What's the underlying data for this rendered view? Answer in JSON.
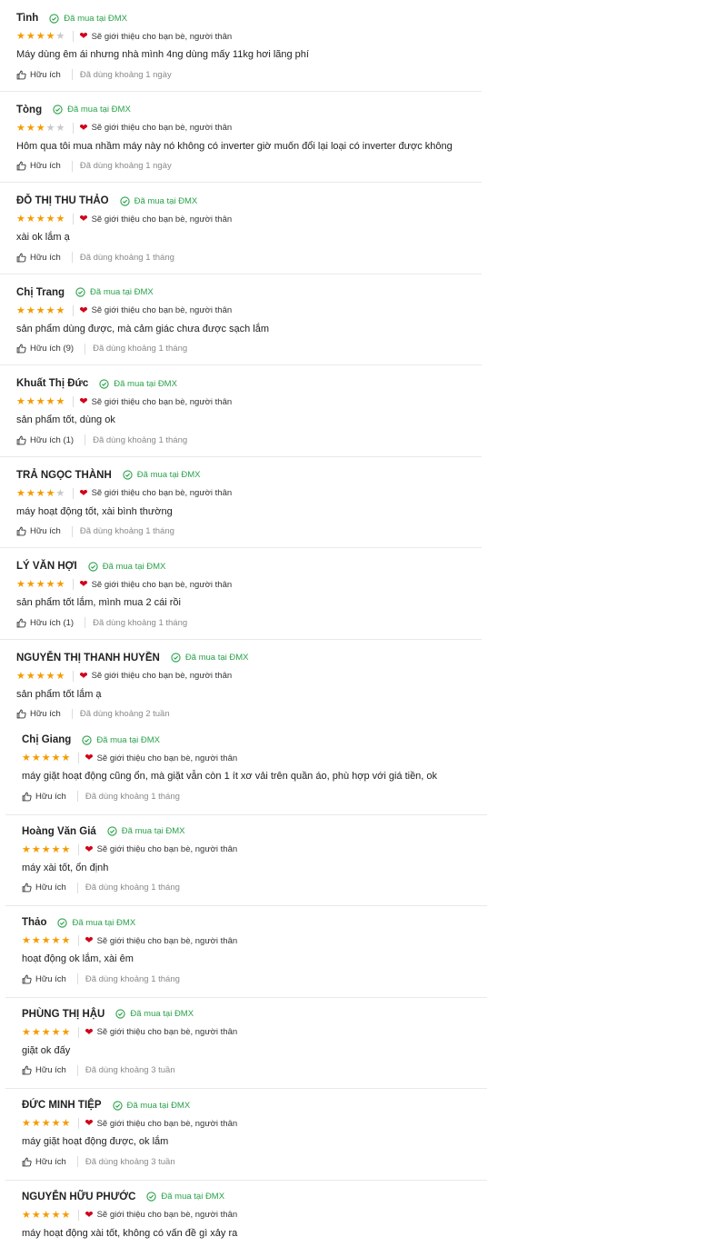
{
  "common": {
    "verified": "Đã mua tại ĐMX",
    "recommend": "Sẽ giới thiệu cho bạn bè, người thân",
    "helpful": "Hữu ích"
  },
  "colors": {
    "star": "#f59b00",
    "star_empty": "#c8c8c8",
    "verified": "#2aa14a",
    "heart": "#d0021b"
  },
  "icons": {
    "verified": "check-circle-icon",
    "recommend": "heart-icon",
    "helpful": "thumbs-up-icon",
    "rating": "star-icon"
  },
  "reviews": [
    {
      "name": "Tình",
      "stars": 4,
      "text": "Máy dùng êm ái nhưng nhà mình 4ng dùng mấy 11kg hơi lãng phí",
      "helpful": "Hữu ích",
      "used": "Đã dùng khoảng 1 ngày"
    },
    {
      "name": "Tòng",
      "stars": 3,
      "text": "Hôm qua tôi mua nhầm máy này nó không có inverter giờ muốn đổi lại loại có inverter được không",
      "helpful": "Hữu ích",
      "used": "Đã dùng khoảng 1 ngày"
    },
    {
      "name": "ĐỖ THỊ THU THẢO",
      "stars": 5,
      "text": "xài ok lắm ạ",
      "helpful": "Hữu ích",
      "used": "Đã dùng khoảng 1 tháng"
    },
    {
      "name": "Chị Trang",
      "stars": 5,
      "text": "sản phẩm dùng được, mà cảm giác chưa được sạch lắm",
      "helpful": "Hữu ích (9)",
      "used": "Đã dùng khoảng 1 tháng"
    },
    {
      "name": "Khuất Thị Đức",
      "stars": 5,
      "text": "sản phẩm tốt, dùng ok",
      "helpful": "Hữu ích (1)",
      "used": "Đã dùng khoảng 1 tháng"
    },
    {
      "name": "TRẢ NGỌC THÀNH",
      "stars": 4,
      "text": "máy hoạt động tốt, xài bình thường",
      "helpful": "Hữu ích",
      "used": "Đã dùng khoảng 1 tháng"
    },
    {
      "name": "LÝ VĂN HỢI",
      "stars": 5,
      "text": "sản phẩm tốt lắm, mình mua 2 cái rồi",
      "helpful": "Hữu ích (1)",
      "used": "Đã dùng khoảng 1 tháng"
    },
    {
      "name": "NGUYỄN THỊ THANH HUYỀN",
      "stars": 5,
      "text": "sản phẩm tốt lắm ạ",
      "helpful": "Hữu ích",
      "used": "Đã dùng khoảng 2 tuần"
    },
    {
      "name": "Chị Giang",
      "stars": 5,
      "text": "máy giặt hoạt động cũng ổn, mà giặt vẫn còn 1 ít xơ vải trên quần áo, phù hợp với giá tiền, ok",
      "helpful": "Hữu ích",
      "used": "Đã dùng khoảng 1 tháng"
    },
    {
      "name": "Hoàng Văn Giá",
      "stars": 5,
      "text": "máy xài tốt, ổn định",
      "helpful": "Hữu ích",
      "used": "Đã dùng khoảng 1 tháng"
    },
    {
      "name": "Thảo",
      "stars": 5,
      "text": "hoạt động ok lắm, xài êm",
      "helpful": "Hữu ích",
      "used": "Đã dùng khoảng 1 tháng"
    },
    {
      "name": "PHÙNG THỊ HẬU",
      "stars": 5,
      "text": "giặt ok đấy",
      "helpful": "Hữu ích",
      "used": "Đã dùng khoảng 3 tuần"
    },
    {
      "name": "ĐỨC MINH TIỆP",
      "stars": 5,
      "text": "máy giặt hoạt động được, ok lắm",
      "helpful": "Hữu ích",
      "used": "Đã dùng khoảng 3 tuần"
    },
    {
      "name": "NGUYỄN HỮU PHƯỚC",
      "stars": 5,
      "text": "máy hoạt động xài tốt, không có vấn đề gì xảy ra",
      "helpful": "",
      "used": ""
    }
  ]
}
